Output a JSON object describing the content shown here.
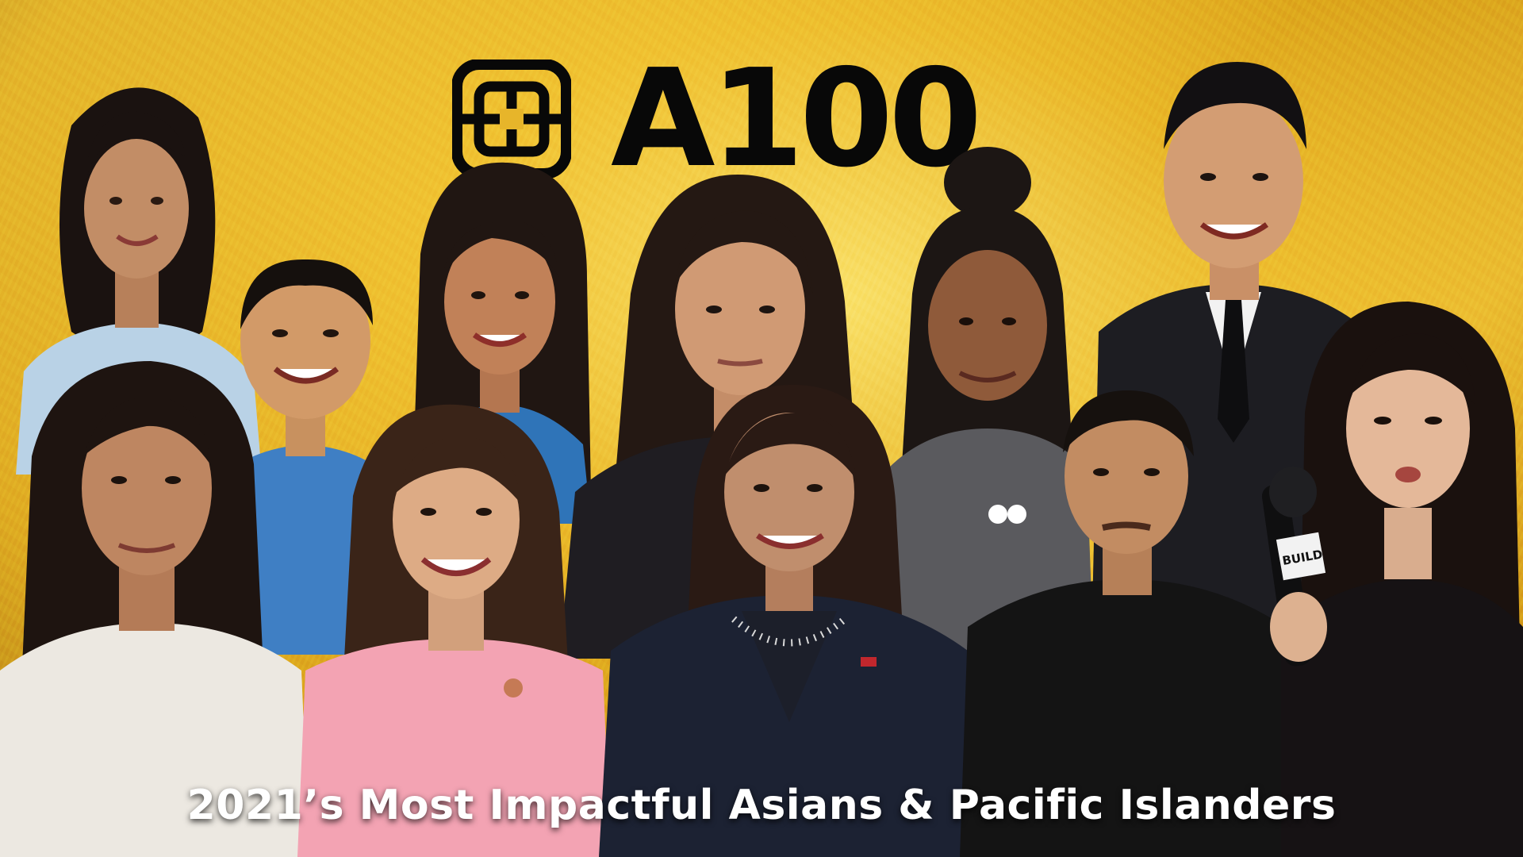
{
  "brand": {
    "logo_mark": "goldhouse-emblem-icon",
    "logo_text": "A100"
  },
  "title": "2021’s Most Impactful Asians & Pacific Islanders",
  "badges": {
    "microphone_label": "BUILD",
    "shirt_logo": "logo-mark"
  },
  "colors": {
    "background": "#e3ad22",
    "logo": "#080808",
    "title": "#ffffff"
  }
}
